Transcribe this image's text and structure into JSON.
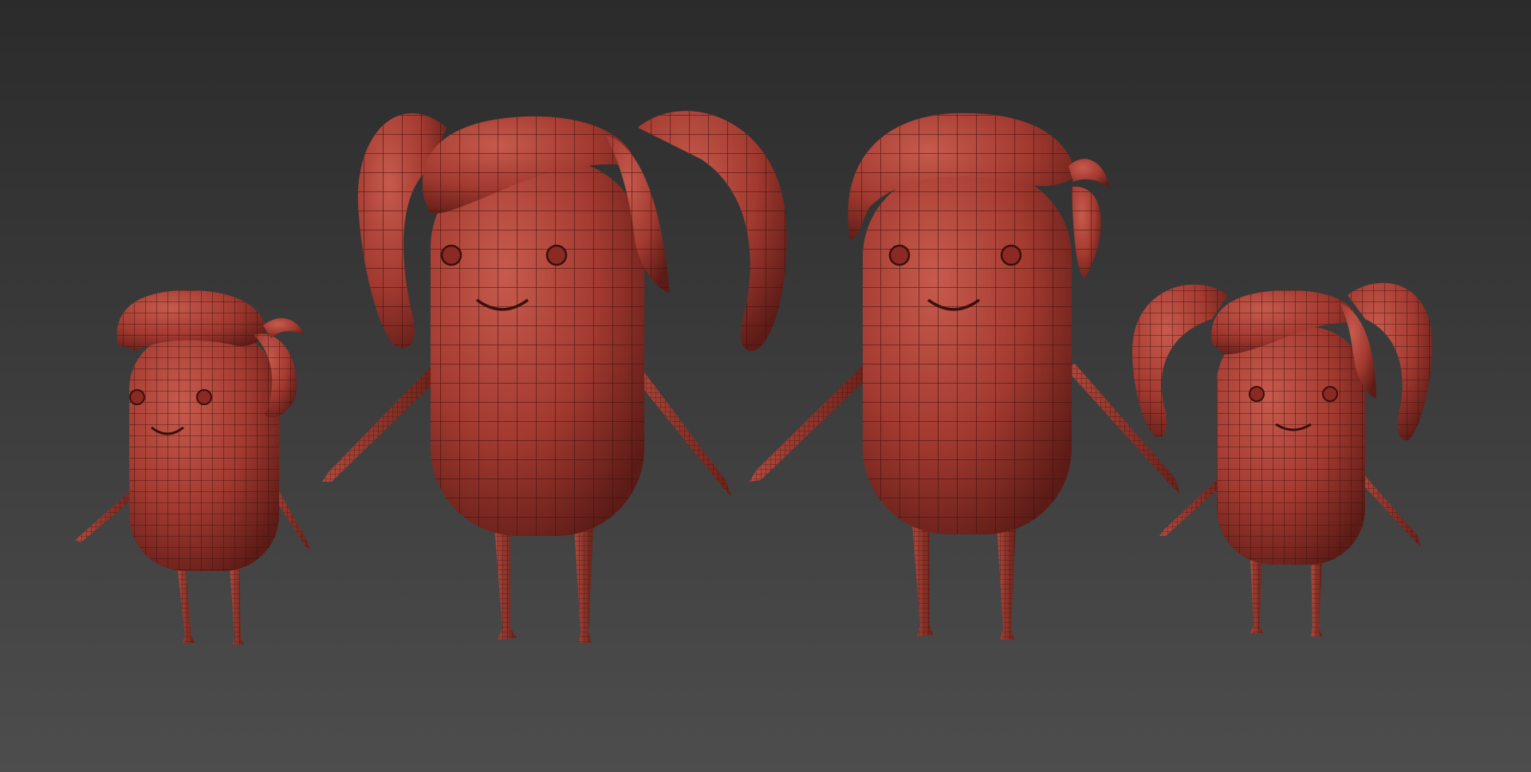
{
  "scene": {
    "background_top": "#2b2b2b",
    "background_bottom": "#4d4d4d",
    "mesh_color": "#a33a30",
    "mesh_highlight": "#c65a4d",
    "mesh_shadow": "#5c1b16",
    "wire_color": "#3a0f0c",
    "figures": [
      {
        "name": "small-boy",
        "hair": "swept"
      },
      {
        "name": "large-girl",
        "hair": "pigtails"
      },
      {
        "name": "large-boy",
        "hair": "swept"
      },
      {
        "name": "small-girl",
        "hair": "pigtails"
      }
    ]
  }
}
